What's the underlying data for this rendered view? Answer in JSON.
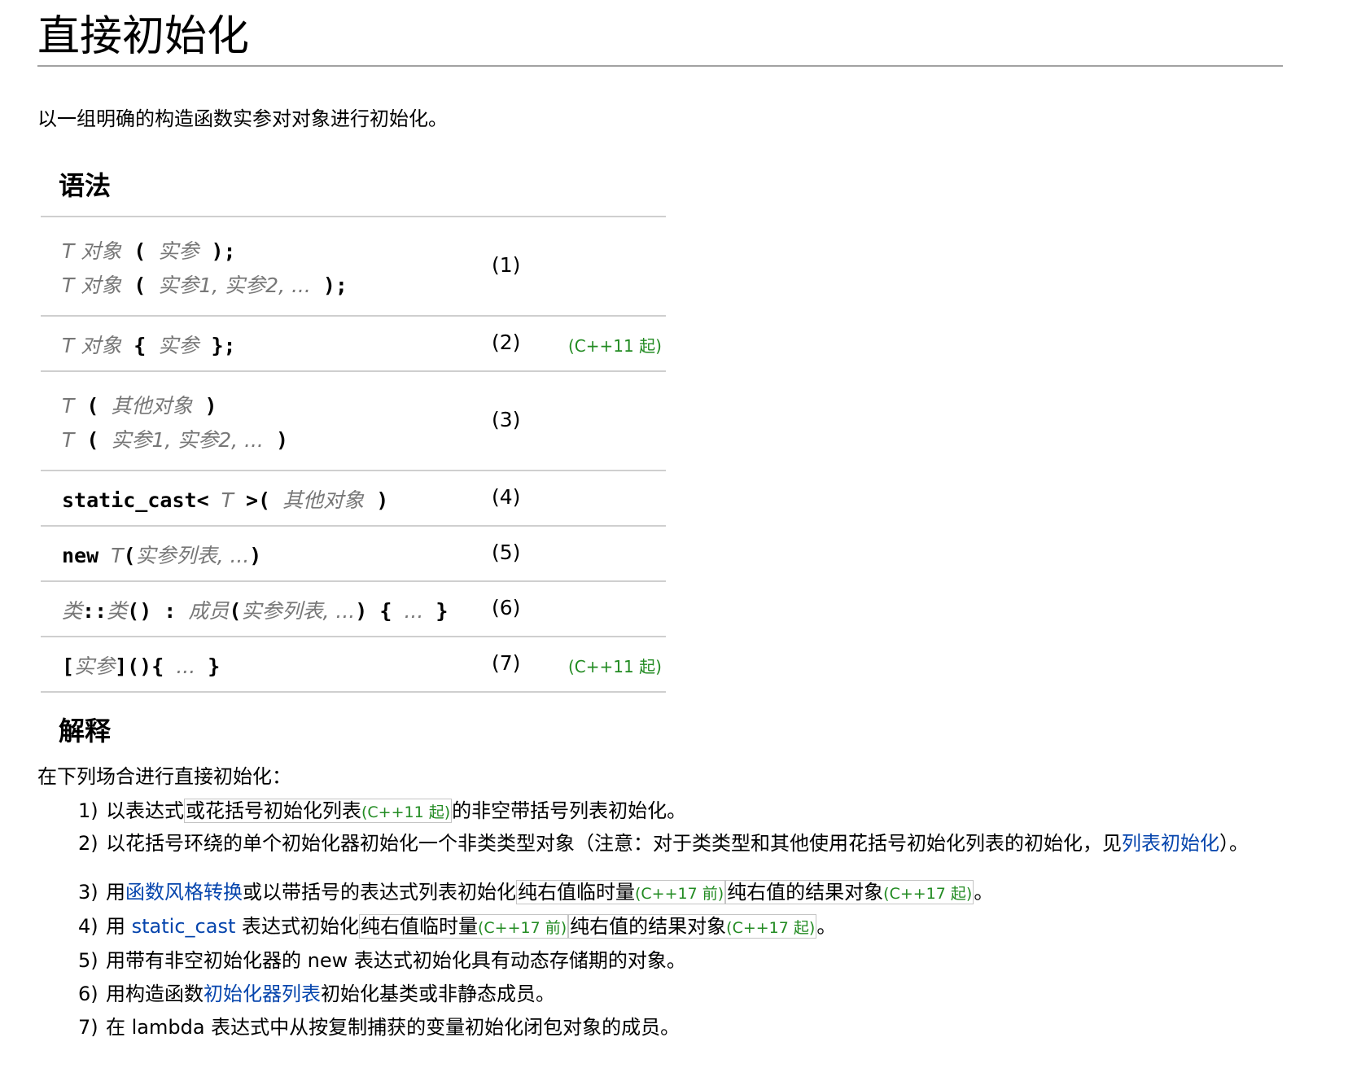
{
  "title": "直接初始化",
  "intro": "以一组明确的构造函数实参对对象进行初始化。",
  "syntax_heading": "语法",
  "syntax_rows": [
    {
      "num": "(1)",
      "since": "",
      "lines": [
        [
          {
            "t": "T 对象",
            "c": "ph"
          },
          {
            "t": " ( ",
            "c": "code"
          },
          {
            "t": "实参",
            "c": "ph"
          },
          {
            "t": " );",
            "c": "code"
          }
        ],
        [
          {
            "t": "T 对象",
            "c": "ph"
          },
          {
            "t": " ( ",
            "c": "code"
          },
          {
            "t": "实参1, 实参2, ...",
            "c": "ph"
          },
          {
            "t": " );",
            "c": "code"
          }
        ]
      ]
    },
    {
      "num": "(2)",
      "since": "(C++11 起)",
      "lines": [
        [
          {
            "t": "T 对象",
            "c": "ph"
          },
          {
            "t": " { ",
            "c": "code"
          },
          {
            "t": "实参",
            "c": "ph"
          },
          {
            "t": " };",
            "c": "code"
          }
        ]
      ]
    },
    {
      "num": "(3)",
      "since": "",
      "lines": [
        [
          {
            "t": "T",
            "c": "ph"
          },
          {
            "t": " ( ",
            "c": "code"
          },
          {
            "t": "其他对象",
            "c": "ph"
          },
          {
            "t": " )",
            "c": "code"
          }
        ],
        [
          {
            "t": "T",
            "c": "ph"
          },
          {
            "t": " ( ",
            "c": "code"
          },
          {
            "t": "实参1, 实参2, ...",
            "c": "ph"
          },
          {
            "t": " )",
            "c": "code"
          }
        ]
      ]
    },
    {
      "num": "(4)",
      "since": "",
      "lines": [
        [
          {
            "t": "static_cast< ",
            "c": "code"
          },
          {
            "t": "T",
            "c": "ph"
          },
          {
            "t": " >( ",
            "c": "code"
          },
          {
            "t": "其他对象",
            "c": "ph"
          },
          {
            "t": " )",
            "c": "code"
          }
        ]
      ]
    },
    {
      "num": "(5)",
      "since": "",
      "lines": [
        [
          {
            "t": "new ",
            "c": "code"
          },
          {
            "t": "T",
            "c": "ph"
          },
          {
            "t": "(",
            "c": "code"
          },
          {
            "t": "实参列表, ...",
            "c": "ph"
          },
          {
            "t": ")",
            "c": "code"
          }
        ]
      ]
    },
    {
      "num": "(6)",
      "since": "",
      "lines": [
        [
          {
            "t": "类",
            "c": "ph"
          },
          {
            "t": "::",
            "c": "code"
          },
          {
            "t": "类",
            "c": "ph"
          },
          {
            "t": "() : ",
            "c": "code"
          },
          {
            "t": "成员",
            "c": "ph"
          },
          {
            "t": "(",
            "c": "code"
          },
          {
            "t": "实参列表, ...",
            "c": "ph"
          },
          {
            "t": ") { ",
            "c": "code"
          },
          {
            "t": "...",
            "c": "ph"
          },
          {
            "t": " }",
            "c": "code"
          }
        ]
      ]
    },
    {
      "num": "(7)",
      "since": "(C++11 起)",
      "lines": [
        [
          {
            "t": "[",
            "c": "code"
          },
          {
            "t": "实参",
            "c": "ph"
          },
          {
            "t": "](){ ",
            "c": "code"
          },
          {
            "t": "...",
            "c": "ph"
          },
          {
            "t": " }",
            "c": "code"
          }
        ]
      ]
    }
  ],
  "explanation_heading": "解释",
  "explanation_intro": "在下列场合进行直接初始化：",
  "items": [
    {
      "num": "1)",
      "parts": [
        {
          "t": "以表达式"
        },
        {
          "t": "或花括号初始化列表",
          "box": true,
          "note": "(C++11 起)"
        },
        {
          "t": "的非空带括号列表初始化。"
        }
      ]
    },
    {
      "num": "2)",
      "parts": [
        {
          "t": "以花括号环绕的单个初始化器初始化一个非类类型对象（注意：对于类类型和其他使用花括号初始化列表的初始化，见"
        },
        {
          "t": "列表初始化",
          "link": true
        },
        {
          "t": "）。"
        }
      ]
    },
    {
      "num": "3)",
      "parts": [
        {
          "t": "用"
        },
        {
          "t": "函数风格转换",
          "link": true
        },
        {
          "t": "或以带括号的表达式列表初始化"
        },
        {
          "t": "纯右值临时量",
          "box": true,
          "note": "(C++17 前)"
        },
        {
          "t": "纯右值的结果对象",
          "box": true,
          "note": "(C++17 起)"
        },
        {
          "t": "。"
        }
      ]
    },
    {
      "num": "4)",
      "parts": [
        {
          "t": "用 "
        },
        {
          "t": "static_cast",
          "link": true
        },
        {
          "t": " 表达式初始化"
        },
        {
          "t": "纯右值临时量",
          "box": true,
          "note": "(C++17 前)"
        },
        {
          "t": "纯右值的结果对象",
          "box": true,
          "note": "(C++17 起)"
        },
        {
          "t": "。"
        }
      ]
    },
    {
      "num": "5)",
      "parts": [
        {
          "t": "用带有非空初始化器的 new 表达式初始化具有动态存储期的对象。"
        }
      ]
    },
    {
      "num": "6)",
      "parts": [
        {
          "t": "用构造函数"
        },
        {
          "t": "初始化器列表",
          "link": true
        },
        {
          "t": "初始化基类或非静态成员。"
        }
      ]
    },
    {
      "num": "7)",
      "parts": [
        {
          "t": "在 lambda 表达式中从按复制捕获的变量初始化闭包对象的成员。"
        }
      ]
    }
  ]
}
